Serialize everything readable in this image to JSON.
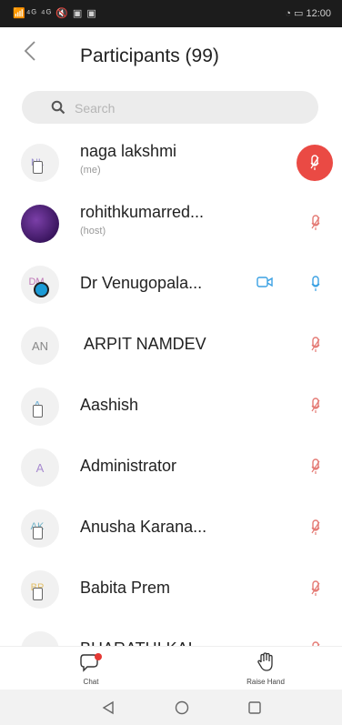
{
  "status": {
    "left": "📶⁴ᴳ ⁴ᴳ 🔇 ▣ ▣",
    "right": "◔ ▭ 12:00"
  },
  "header": {
    "title": "Participants (99)"
  },
  "search": {
    "placeholder": "Search"
  },
  "participants": [
    {
      "initials": "NL",
      "name": "naga lakshmi",
      "role": "(me)"
    },
    {
      "initials": "",
      "name": "rohithkumarred...",
      "role": "(host)"
    },
    {
      "initials": "DM",
      "name": "Dr Venugopala..."
    },
    {
      "initials": "AN",
      "name": "ARPIT NAMDEV"
    },
    {
      "initials": "A",
      "name": "Aashish"
    },
    {
      "initials": "A",
      "name": "Administrator"
    },
    {
      "initials": "AK",
      "name": "Anusha Karana..."
    },
    {
      "initials": "BP",
      "name": "Babita Prem"
    },
    {
      "initials": "BK",
      "name": "BHARATHI KAL..."
    }
  ],
  "bottom": {
    "chat_label": "Chat",
    "raise_label": "Raise Hand"
  },
  "colors": {
    "muted_mic": "#e47a74",
    "raised": "#ea4a44",
    "unmuted": "#3ba1e3"
  }
}
